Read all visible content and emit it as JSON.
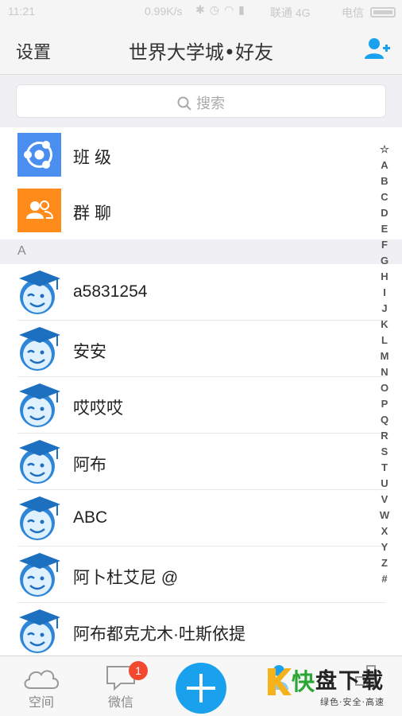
{
  "status_bar": {
    "time": "11:21",
    "network_speed": "0.99K/s",
    "carrier1": "联通 4G",
    "carrier2": "电信"
  },
  "nav": {
    "left_label": "设置",
    "title": "世界大学城•好友",
    "add_icon": "add-friend-icon"
  },
  "search": {
    "placeholder": "搜索"
  },
  "groups": [
    {
      "label": "班级",
      "icon": "class-share-icon",
      "color": "#4a8ef0"
    },
    {
      "label": "群聊",
      "icon": "group-chat-icon",
      "color": "#ff8c1a"
    }
  ],
  "section": {
    "letter": "A"
  },
  "contacts": [
    {
      "name": "a5831254"
    },
    {
      "name": "安安"
    },
    {
      "name": "哎哎哎"
    },
    {
      "name": "阿布"
    },
    {
      "name": "ABC"
    },
    {
      "name": "阿卜杜艾尼 @"
    },
    {
      "name": "阿布都克尤木·吐斯依提"
    }
  ],
  "index_letters": [
    "☆",
    "A",
    "B",
    "C",
    "D",
    "E",
    "F",
    "G",
    "H",
    "I",
    "J",
    "K",
    "L",
    "M",
    "N",
    "O",
    "P",
    "Q",
    "R",
    "S",
    "T",
    "U",
    "V",
    "W",
    "X",
    "Y",
    "Z",
    "#"
  ],
  "tabs": {
    "space_label": "空间",
    "wechat_label": "微信",
    "wechat_badge": "1",
    "fab_icon": "plus-icon"
  },
  "watermark": {
    "kuai": "快",
    "main": "盘下载",
    "sub": "绿色·安全·高速"
  },
  "colors": {
    "accent": "#1aa1ee",
    "badge": "#f2482f"
  }
}
